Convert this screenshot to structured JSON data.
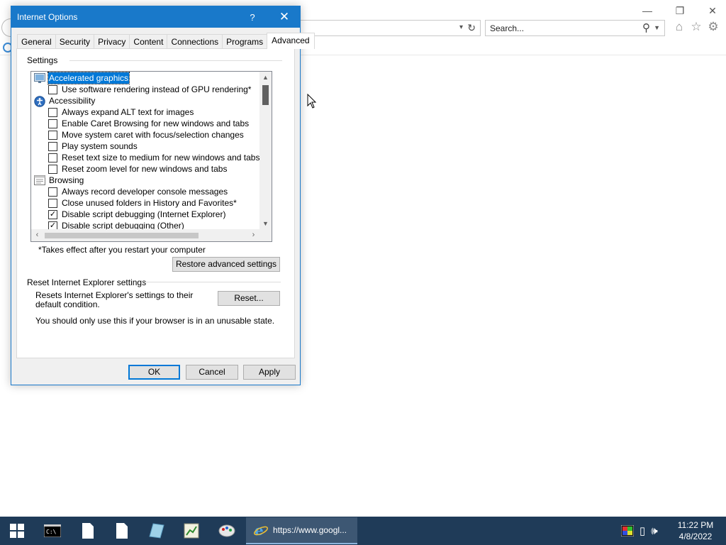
{
  "browser": {
    "search_placeholder": "Search..."
  },
  "dialog": {
    "title": "Internet Options",
    "help_glyph": "?",
    "close_glyph": "✕",
    "tabs": [
      {
        "label": "General"
      },
      {
        "label": "Security"
      },
      {
        "label": "Privacy"
      },
      {
        "label": "Content"
      },
      {
        "label": "Connections"
      },
      {
        "label": "Programs"
      },
      {
        "label": "Advanced",
        "active": true
      }
    ],
    "settings_group_label": "Settings",
    "settings_list": [
      {
        "type": "category",
        "label": "Accelerated graphics",
        "icon": "monitor-icon",
        "selected": true
      },
      {
        "type": "option",
        "label": "Use software rendering instead of GPU rendering*",
        "checked": false
      },
      {
        "type": "category",
        "label": "Accessibility",
        "icon": "accessibility-icon"
      },
      {
        "type": "option",
        "label": "Always expand ALT text for images",
        "checked": false
      },
      {
        "type": "option",
        "label": "Enable Caret Browsing for new windows and tabs",
        "checked": false
      },
      {
        "type": "option",
        "label": "Move system caret with focus/selection changes",
        "checked": false
      },
      {
        "type": "option",
        "label": "Play system sounds",
        "checked": false
      },
      {
        "type": "option",
        "label": "Reset text size to medium for new windows and tabs",
        "checked": false
      },
      {
        "type": "option",
        "label": "Reset zoom level for new windows and tabs",
        "checked": false
      },
      {
        "type": "category",
        "label": "Browsing",
        "icon": "browsing-page-icon"
      },
      {
        "type": "option",
        "label": "Always record developer console messages",
        "checked": false
      },
      {
        "type": "option",
        "label": "Close unused folders in History and Favorites*",
        "checked": false
      },
      {
        "type": "option",
        "label": "Disable script debugging (Internet Explorer)",
        "checked": true
      },
      {
        "type": "option",
        "label": "Disable script debugging (Other)",
        "checked": true
      }
    ],
    "restart_note": "*Takes effect after you restart your computer",
    "restore_button": "Restore advanced settings",
    "reset_group_label": "Reset Internet Explorer settings",
    "reset_description": "Resets Internet Explorer's settings to their default condition.",
    "reset_button": "Reset...",
    "reset_warning": "You should only use this if your browser is in an unusable state.",
    "ok_button": "OK",
    "cancel_button": "Cancel",
    "apply_button": "Apply"
  },
  "taskbar": {
    "ie_task_label": "https://www.googl...",
    "clock_time": "11:22 PM",
    "clock_date": "4/8/2022"
  },
  "colors": {
    "titlebar": "#1979ca",
    "selection": "#0078d7",
    "taskbar": "#1f3b58"
  }
}
